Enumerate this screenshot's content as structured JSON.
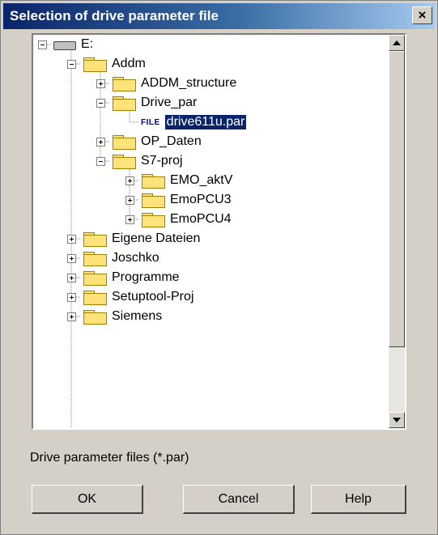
{
  "window": {
    "title": "Selection of drive parameter file",
    "close_glyph": "×"
  },
  "tree": {
    "root": {
      "label": "E:",
      "icon": "drive-icon",
      "expanded": true
    },
    "nodes": [
      {
        "label": "Addm",
        "level": 1,
        "expander": "minus",
        "icon": "folder-icon"
      },
      {
        "label": "ADDM_structure",
        "level": 2,
        "expander": "plus",
        "icon": "folder-icon"
      },
      {
        "label": "Drive_par",
        "level": 2,
        "expander": "minus",
        "icon": "folder-icon"
      },
      {
        "label": "drive611u.par",
        "level": 3,
        "expander": "none",
        "icon": "file-icon",
        "icon_text": "FILE",
        "selected": true
      },
      {
        "label": "OP_Daten",
        "level": 2,
        "expander": "plus",
        "icon": "folder-icon"
      },
      {
        "label": "S7-proj",
        "level": 2,
        "expander": "minus",
        "icon": "folder-icon"
      },
      {
        "label": "EMO_aktV",
        "level": 3,
        "expander": "plus",
        "icon": "folder-icon"
      },
      {
        "label": "EmoPCU3",
        "level": 3,
        "expander": "plus",
        "icon": "folder-icon"
      },
      {
        "label": "EmoPCU4",
        "level": 3,
        "expander": "plus",
        "icon": "folder-icon"
      },
      {
        "label": "Eigene Dateien",
        "level": 1,
        "expander": "plus",
        "icon": "folder-icon"
      },
      {
        "label": "Joschko",
        "level": 1,
        "expander": "plus",
        "icon": "folder-icon"
      },
      {
        "label": "Programme",
        "level": 1,
        "expander": "plus",
        "icon": "folder-icon"
      },
      {
        "label": "Setuptool-Proj",
        "level": 1,
        "expander": "plus",
        "icon": "folder-icon"
      },
      {
        "label": "Siemens",
        "level": 1,
        "expander": "plus",
        "icon": "folder-icon"
      }
    ]
  },
  "scrollbar": {
    "position_fraction": 0.0,
    "visible_fraction": 0.82
  },
  "filter_label": "Drive parameter files (*.par)",
  "buttons": {
    "ok": "OK",
    "cancel": "Cancel",
    "help": "Help"
  },
  "colors": {
    "title_bar": "#0a246a",
    "selection": "#0a246a",
    "face": "#d4d0c8",
    "folder": "#ffe37a"
  }
}
